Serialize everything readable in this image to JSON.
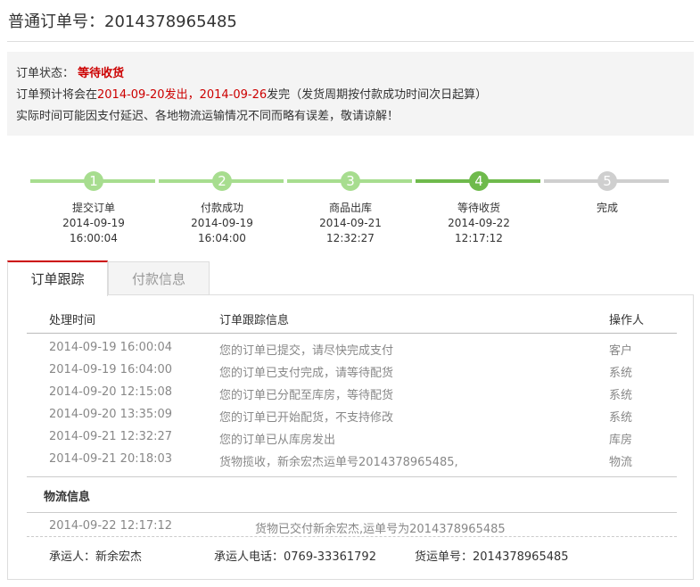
{
  "order": {
    "title_label": "普通订单号：",
    "number": "2014378965485"
  },
  "notice": {
    "status_label": "订单状态：",
    "status_value": "等待收货",
    "line2_a": "订单预计将会在",
    "line2_date1": "2014-09-20",
    "line2_b": "发出，",
    "line2_date2": "2014-09-26",
    "line2_c": "发完（发货周期按付款成功时间次日起算）",
    "line3": "实际时间可能因支付延迟、各地物流运输情况不同而略有误差，敬请谅解！"
  },
  "steps": [
    {
      "num": "1",
      "label": "提交订单",
      "date": "2014-09-19",
      "time": "16:00:04",
      "state": "done"
    },
    {
      "num": "2",
      "label": "付款成功",
      "date": "2014-09-19",
      "time": "16:04:00",
      "state": "done"
    },
    {
      "num": "3",
      "label": "商品出库",
      "date": "2014-09-21",
      "time": "12:32:27",
      "state": "done"
    },
    {
      "num": "4",
      "label": "等待收货",
      "date": "2014-09-22",
      "time": "12:17:12",
      "state": "current"
    },
    {
      "num": "5",
      "label": "完成",
      "date": "",
      "time": "",
      "state": "todo"
    }
  ],
  "tabs": {
    "tracking": "订单跟踪",
    "payment": "付款信息"
  },
  "tracking": {
    "col_time": "处理时间",
    "col_info": "订单跟踪信息",
    "col_operator": "操作人",
    "rows": [
      {
        "time": "2014-09-19 16:00:04",
        "info": "您的订单已提交，请尽快完成支付",
        "operator": "客户"
      },
      {
        "time": "2014-09-19 16:04:00",
        "info": "您的订单已支付完成，请等待配货",
        "operator": "系统"
      },
      {
        "time": "2014-09-20 12:15:08",
        "info": "您的订单已分配至库房，等待配货",
        "operator": "系统"
      },
      {
        "time": "2014-09-20 13:35:09",
        "info": "您的订单已开始配货，不支持修改",
        "operator": "系统"
      },
      {
        "time": "2014-09-21 12:32:27",
        "info": "您的订单已从库房发出",
        "operator": "库房"
      },
      {
        "time": "2014-09-21 20:18:03",
        "info": "货物揽收，新余宏杰运单号2014378965485,",
        "operator": "物流"
      }
    ]
  },
  "logistics": {
    "title": "物流信息",
    "time": "2014-09-22 12:17:12",
    "info": "货物已交付新余宏杰,运单号为2014378965485",
    "carrier_label": "承运人：",
    "carrier_value": "新余宏杰",
    "phone_label": "承运人电话：",
    "phone_value": "0769-33361792",
    "waybill_label": "货运单号：",
    "waybill_value": "2014378965485"
  },
  "colors": {
    "accent_red": "#cc0000",
    "step_done": "#a7dd8f",
    "step_current": "#6fba4c",
    "step_todo": "#cfcfcf"
  }
}
